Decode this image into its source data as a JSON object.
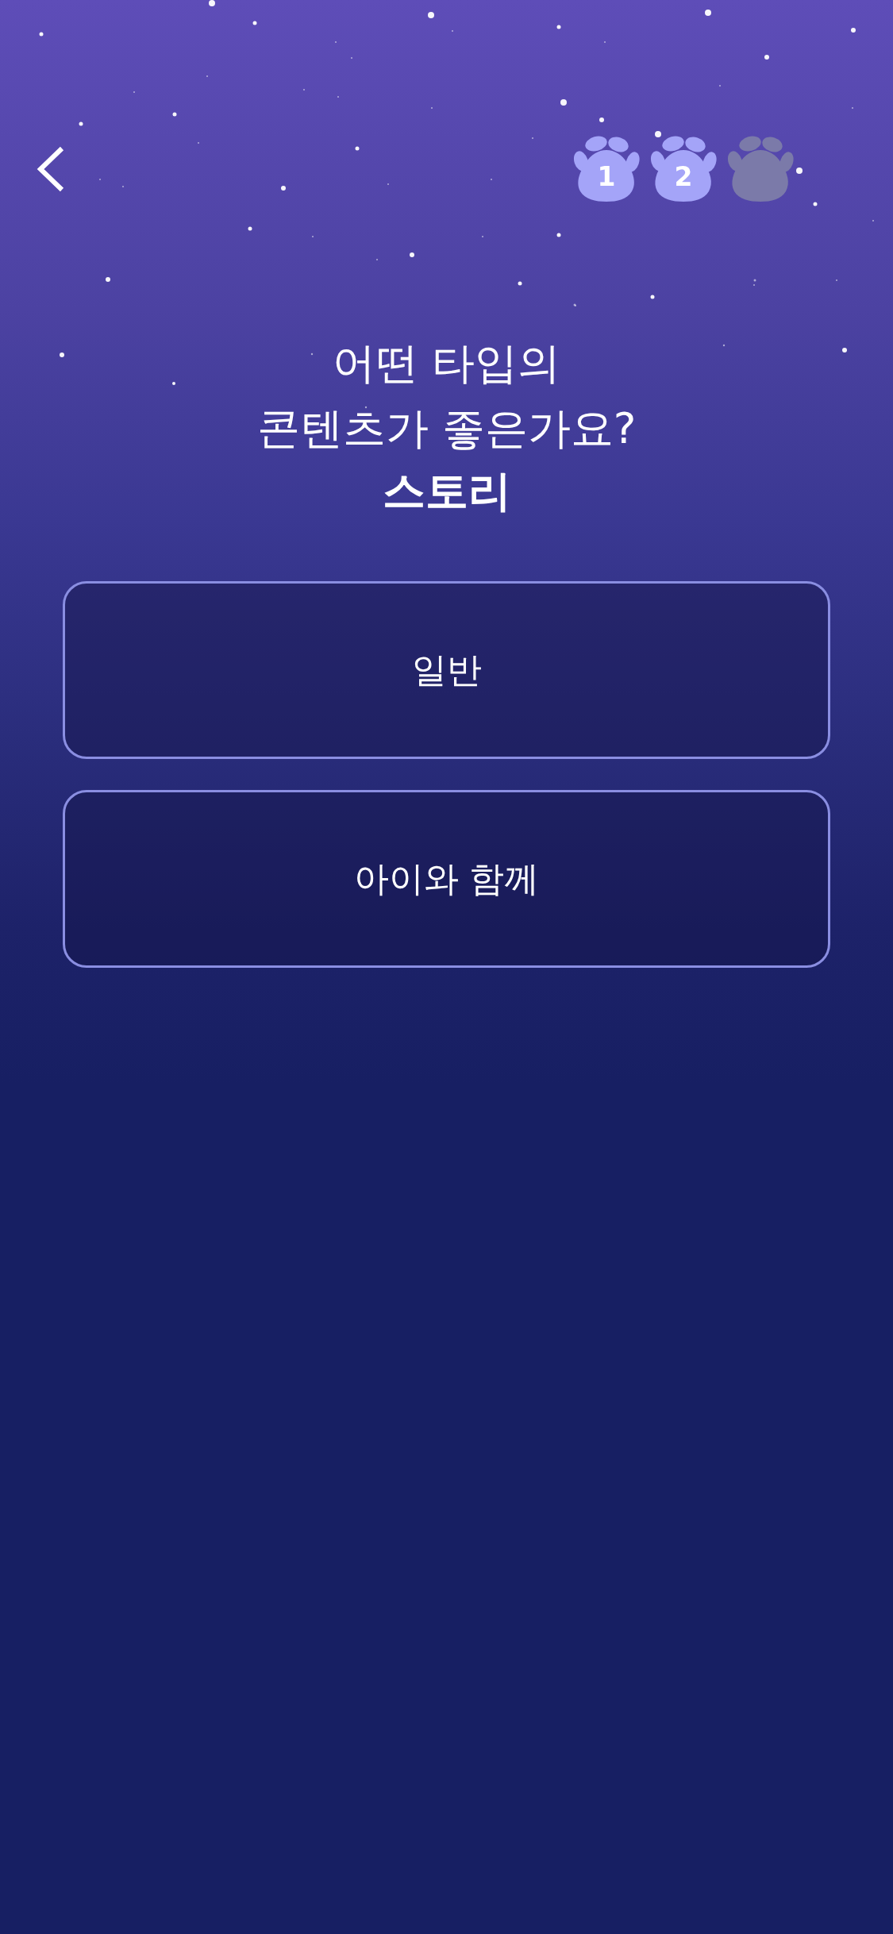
{
  "steps": [
    {
      "label": "1",
      "completed": true
    },
    {
      "label": "2",
      "completed": true
    },
    {
      "completed": false
    }
  ],
  "question": {
    "text": "어떤 타입의\n콘텐츠가 좋은가요?",
    "category": "스토리"
  },
  "options": [
    {
      "label": "일반",
      "selected": false
    },
    {
      "label": "아이와 함께",
      "selected": false
    }
  ]
}
